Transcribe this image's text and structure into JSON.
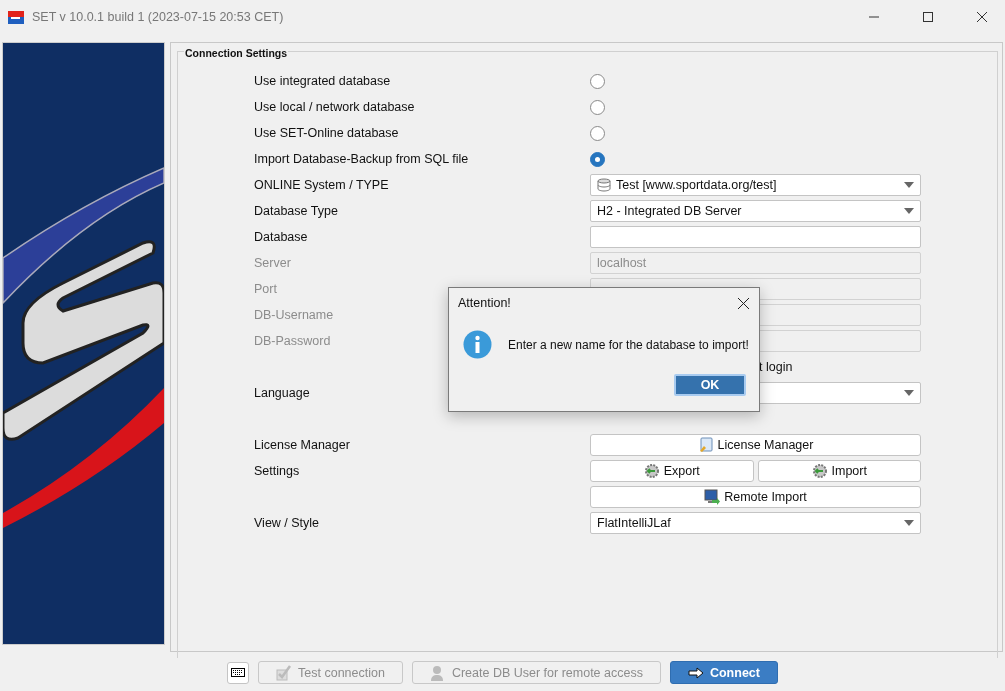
{
  "window": {
    "title": "SET v 10.0.1 build 1 (2023-07-15 20:53 CET)"
  },
  "group": {
    "title": "Connection Settings"
  },
  "rows": [
    {
      "kind": "radio",
      "label": "Use integrated database",
      "selected": false
    },
    {
      "kind": "radio",
      "label": "Use local / network database",
      "selected": false
    },
    {
      "kind": "radio",
      "label": "Use SET-Online database",
      "selected": false
    },
    {
      "kind": "radio",
      "label": "Import Database-Backup from SQL file",
      "selected": true
    },
    {
      "kind": "select",
      "label": "ONLINE System / TYPE",
      "value": "Test [www.sportdata.org/test]"
    },
    {
      "kind": "select",
      "label": "Database Type",
      "value": "H2 - Integrated DB Server"
    },
    {
      "kind": "input",
      "label": "Database",
      "disabled": false
    },
    {
      "kind": "input",
      "label": "Server",
      "value": "localhost",
      "disabled": true
    },
    {
      "kind": "input",
      "label": "Port",
      "disabled": true
    },
    {
      "kind": "input",
      "label": "DB-Username",
      "disabled": true
    },
    {
      "kind": "input",
      "label": "DB-Password",
      "disabled": true
    },
    {
      "kind": "check",
      "text": "t login"
    },
    {
      "kind": "select",
      "label": "Language"
    }
  ],
  "tool_rows": [
    {
      "label": "License Manager",
      "buttons": [
        {
          "label": "License Manager"
        }
      ]
    },
    {
      "label": "Settings",
      "buttons": [
        {
          "label": "Export"
        },
        {
          "label": "Import"
        }
      ]
    },
    {
      "buttons": [
        {
          "label": "Remote Import"
        }
      ]
    },
    {
      "label": "View / Style",
      "select": "FlatIntelliJLaf"
    }
  ],
  "footer": {
    "buttons": [
      {
        "label": "Test connection",
        "disabled": true,
        "primary": false
      },
      {
        "label": "Create DB User for remote access",
        "disabled": true,
        "primary": false
      },
      {
        "label": "Connect",
        "disabled": false,
        "primary": true
      }
    ]
  },
  "dialog": {
    "title": "Attention!",
    "message": "Enter a new name for the database to import!",
    "button": "OK"
  }
}
